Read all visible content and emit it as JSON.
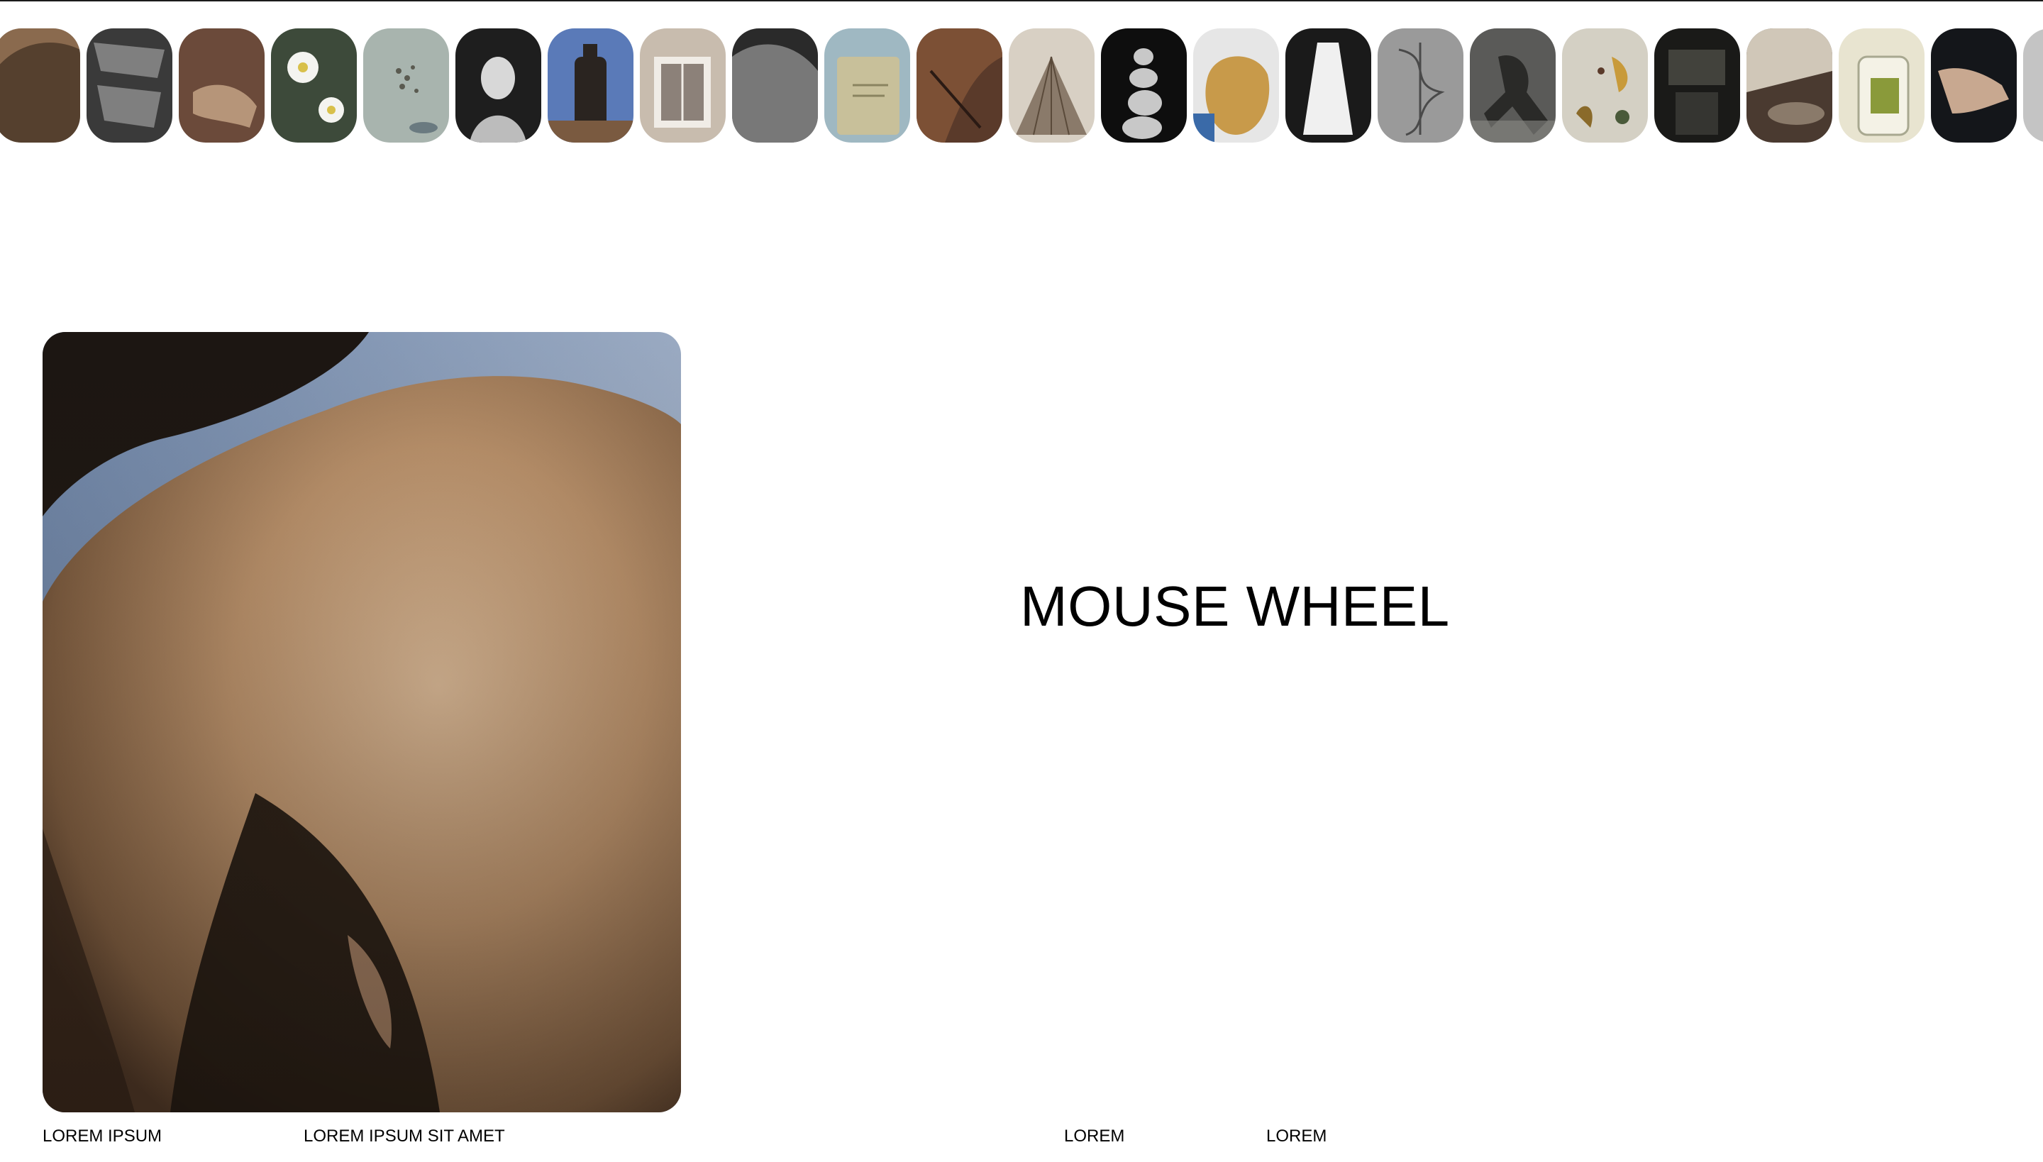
{
  "headline": "MOUSE WHEEL",
  "captions": [
    "LOREM IPSUM",
    "LOREM IPSUM SIT AMET",
    "LOREM",
    "LOREM"
  ],
  "thumbnails": [
    {
      "name": "thumb-back-closeup",
      "bg": "#8a6a4e",
      "fg": "#2a1d14",
      "motif": "back"
    },
    {
      "name": "thumb-crumpled-foil",
      "bg": "#3a3a3a",
      "fg": "#b8b8b8",
      "motif": "foil"
    },
    {
      "name": "thumb-feet-sandals",
      "bg": "#6b4a3a",
      "fg": "#c9a88a",
      "motif": "feet"
    },
    {
      "name": "thumb-daisies",
      "bg": "#3d4a3a",
      "fg": "#f4f4f0",
      "motif": "flowers"
    },
    {
      "name": "thumb-seeds",
      "bg": "#a8b4ae",
      "fg": "#5a5a50",
      "motif": "seeds"
    },
    {
      "name": "thumb-portrait-bw",
      "bg": "#1e1e1e",
      "fg": "#d8d8d8",
      "motif": "portrait"
    },
    {
      "name": "thumb-bottle",
      "bg": "#5a7ab8",
      "fg": "#2a2420",
      "motif": "bottle"
    },
    {
      "name": "thumb-window",
      "bg": "#c8bcae",
      "fg": "#4a3a30",
      "motif": "window"
    },
    {
      "name": "thumb-hair-bw",
      "bg": "#2a2a2a",
      "fg": "#9a9a9a",
      "motif": "hair"
    },
    {
      "name": "thumb-soap-bar",
      "bg": "#9fb8c2",
      "fg": "#c8c09a",
      "motif": "soap"
    },
    {
      "name": "thumb-horse",
      "bg": "#5a3a2a",
      "fg": "#2a1a14",
      "motif": "horse"
    },
    {
      "name": "thumb-pleated-lamp",
      "bg": "#d8d0c4",
      "fg": "#8a7a6a",
      "motif": "lamp"
    },
    {
      "name": "thumb-stacked-stones",
      "bg": "#0e0e0e",
      "fg": "#c8c8c8",
      "motif": "stones"
    },
    {
      "name": "thumb-golden-bag",
      "bg": "#e6e6e6",
      "fg": "#c89a4a",
      "motif": "bag"
    },
    {
      "name": "thumb-white-dress",
      "bg": "#1a1a1a",
      "fg": "#f0f0f0",
      "motif": "dress"
    },
    {
      "name": "thumb-wire-sculpture",
      "bg": "#9a9a9a",
      "fg": "#4a4a4a",
      "motif": "wire"
    },
    {
      "name": "thumb-crouching-figure",
      "bg": "#5a5a58",
      "fg": "#2a2a28",
      "motif": "figure"
    },
    {
      "name": "thumb-dried-leaves",
      "bg": "#d4d0c4",
      "fg": "#8a6a2a",
      "motif": "leaves"
    },
    {
      "name": "thumb-shadow-chair",
      "bg": "#1a1a18",
      "fg": "#6a6a60",
      "motif": "chair"
    },
    {
      "name": "thumb-linen-shoe",
      "bg": "#4a3a30",
      "fg": "#e8e0d0",
      "motif": "shoe"
    },
    {
      "name": "thumb-glass-jar",
      "bg": "#e8e4d0",
      "fg": "#8a9a3a",
      "motif": "jar"
    },
    {
      "name": "thumb-open-hand",
      "bg": "#14161a",
      "fg": "#c8a890",
      "motif": "hand"
    },
    {
      "name": "thumb-partial",
      "bg": "#d8d8d8",
      "fg": "#a8a8a8",
      "motif": "blank"
    }
  ]
}
